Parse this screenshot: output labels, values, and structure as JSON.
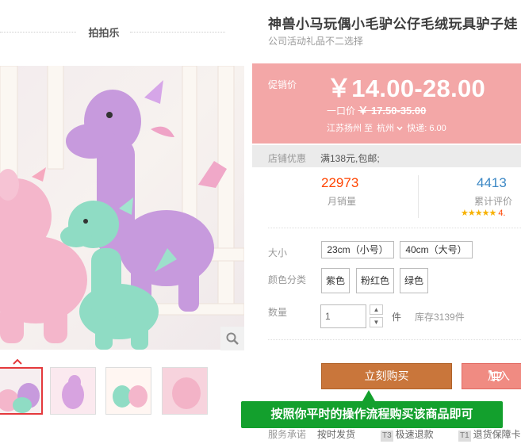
{
  "shop": {
    "name": "拍拍乐"
  },
  "product": {
    "title": "神兽小马玩偶小毛驴公仔毛绒玩具驴子娃",
    "subtitle": "公司活动礼品不二选择"
  },
  "price": {
    "label": "促销价",
    "current": "￥14.00-28.00",
    "original_label": "一口价",
    "original": "￥ 17.50-35.00",
    "ship_from": "江苏扬州",
    "ship_to_word": "至",
    "ship_to": "杭州",
    "express": "快递: 6.00"
  },
  "promo": {
    "label": "店铺优惠",
    "text": "满138元,包邮;"
  },
  "stats": {
    "monthly_sales": "22973",
    "monthly_sales_label": "月销量",
    "reviews": "4413",
    "reviews_label": "累计评价",
    "stars": "★★★★★",
    "rating": "4."
  },
  "options": {
    "size_label": "大小",
    "sizes": [
      "23cm（小号）",
      "40cm（大号）"
    ],
    "color_label": "颜色分类",
    "colors": [
      "紫色",
      "粉红色",
      "绿色"
    ]
  },
  "quantity": {
    "label": "数量",
    "value": "1",
    "up": "▲",
    "down": "▼",
    "unit": "件",
    "stock": "库存3139件"
  },
  "actions": {
    "buy": "立刻购买",
    "cart": "加入"
  },
  "tip": "按照你平时的操作流程购买该商品即可",
  "service": {
    "label": "服务承诺",
    "items": [
      {
        "badge": "",
        "text": "按时发货"
      },
      {
        "badge": "T3",
        "text": "极速退款"
      },
      {
        "badge": "T1",
        "text": "退货保障卡"
      }
    ]
  },
  "colors": {
    "price_bg": "#f3a7a7",
    "buy_bg": "#c9763b",
    "cart_bg": "#f08b82",
    "tip_bg": "#13a02d",
    "sales": "#ff4400",
    "reviews": "#3c88c5"
  },
  "icons": {
    "zoom": "search-icon",
    "thumb_prev": "chevron-up-icon",
    "cart": "shopping-cart-icon",
    "ship_to_dropdown": "chevron-down-icon"
  }
}
